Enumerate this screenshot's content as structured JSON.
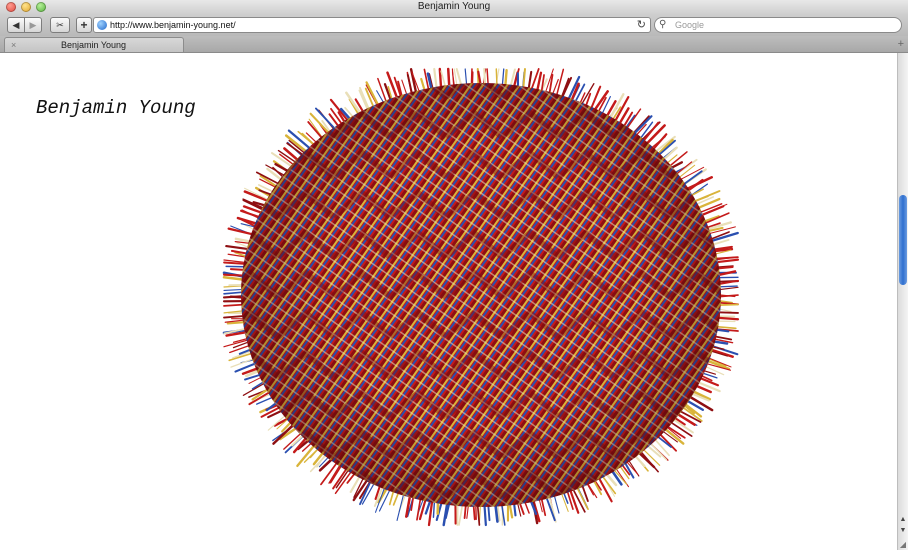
{
  "window": {
    "title": "Benjamin Young"
  },
  "toolbar": {
    "back_icon": "◀",
    "forward_icon": "▶",
    "snippet_icon": "✂",
    "add_bookmark_icon": "+",
    "url": "http://www.benjamin-young.net/",
    "reload_icon": "↻",
    "search_icon": "🔍",
    "search_placeholder": "Google"
  },
  "tabs": [
    {
      "label": "Benjamin Young"
    }
  ],
  "page": {
    "site_title": "Benjamin Young",
    "artwork": {
      "kind": "woven-textile-disc",
      "colors": {
        "warp_red": "#c41a1a",
        "dark_red": "#8e0f12",
        "gold": "#d9b43a",
        "blue": "#2a4fb0",
        "cream": "#e9dfb8"
      }
    }
  },
  "scroll": {
    "position_fraction": 0.28
  }
}
